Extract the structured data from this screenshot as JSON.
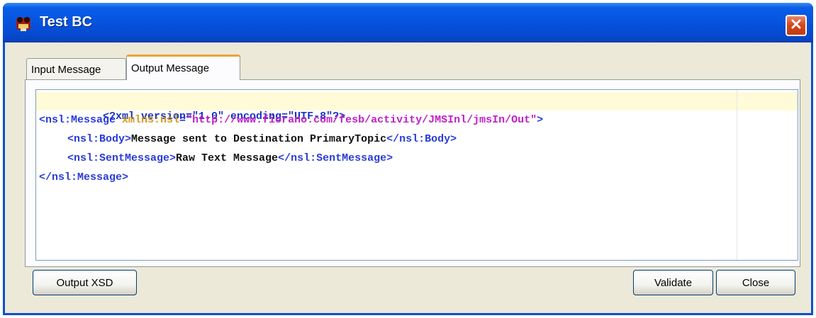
{
  "window": {
    "title": "Test BC",
    "icons": {
      "app": "app-icon",
      "close": "close-icon"
    }
  },
  "tabs": [
    {
      "label": "Input Message",
      "selected": false
    },
    {
      "label": "Output Message",
      "selected": true
    }
  ],
  "editor": {
    "line1": {
      "decl": "<?xml version=\"1.0\" encoding=\"UTF-8\"?>"
    },
    "line2": {
      "open": "<nsl:Message ",
      "attr": "xmlns:nsl",
      "eq": "=",
      "value": "\"http://www.fiorano.com/fesb/activity/JMSInl/jmsIn/Out\"",
      "close": ">"
    },
    "line3": {
      "open": "<nsl:Body>",
      "text": "Message sent to Destination PrimaryTopic",
      "close": "</nsl:Body>"
    },
    "line4": {
      "open": "<nsl:SentMessage>",
      "text": "Raw Text Message",
      "close": "</nsl:SentMessage>"
    },
    "line5": {
      "close": "</nsl:Message>"
    }
  },
  "buttons": {
    "output_xsd": "Output XSD",
    "validate": "Validate",
    "close": "Close"
  },
  "colors": {
    "titlebar": "#0553de",
    "tag": "#2a3bd9",
    "attribute": "#d39a1f",
    "value": "#c020c8",
    "tab_highlight": "#e8a33a"
  }
}
